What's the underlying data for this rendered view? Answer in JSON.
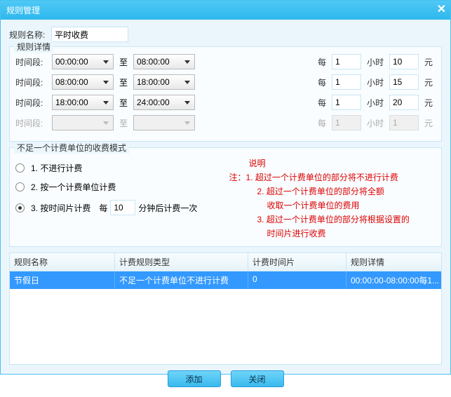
{
  "window": {
    "title": "规则管理"
  },
  "ruleName": {
    "label": "规则名称:",
    "value": "平时收费"
  },
  "detail": {
    "legend": "规则详情",
    "slotLabel": "时间段:",
    "to": "至",
    "every": "每",
    "hour": "小时",
    "yuan": "元",
    "rows": [
      {
        "from": "00:00:00",
        "to": "08:00:00",
        "qty": "1",
        "price": "10",
        "enabled": true
      },
      {
        "from": "08:00:00",
        "to": "18:00:00",
        "qty": "1",
        "price": "15",
        "enabled": true
      },
      {
        "from": "18:00:00",
        "to": "24:00:00",
        "qty": "1",
        "price": "20",
        "enabled": true
      },
      {
        "from": "",
        "to": "",
        "qty": "1",
        "price": "1",
        "enabled": false
      }
    ]
  },
  "mode": {
    "legend": "不足一个计费单位的收费模式",
    "options": [
      {
        "label": "1. 不进行计费",
        "checked": false
      },
      {
        "label": "2. 按一个计费单位计费",
        "checked": false
      },
      {
        "label": "3. 按时间片计费",
        "checked": true
      }
    ],
    "inline": {
      "every": "每",
      "value": "10",
      "suffix": "分钟后计费一次"
    }
  },
  "notes": {
    "head": "说明",
    "prefix": "注：",
    "lines": [
      "1. 超过一个计费单位的部分将不进行计费",
      "2. 超过一个计费单位的部分将全额",
      "收取一个计费单位的费用",
      "3. 超过一个计费单位的部分将根据设置的",
      "时间片进行收费"
    ]
  },
  "table": {
    "headers": [
      "规则名称",
      "计费规则类型",
      "计费时间片",
      "规则详情"
    ],
    "rows": [
      {
        "c1": "节假日",
        "c2": "不足一个计费单位不进行计费",
        "c3": "0",
        "c4": "00:00:00-08:00:00每1..."
      }
    ]
  },
  "footer": {
    "add": "添加",
    "close": "关闭"
  }
}
